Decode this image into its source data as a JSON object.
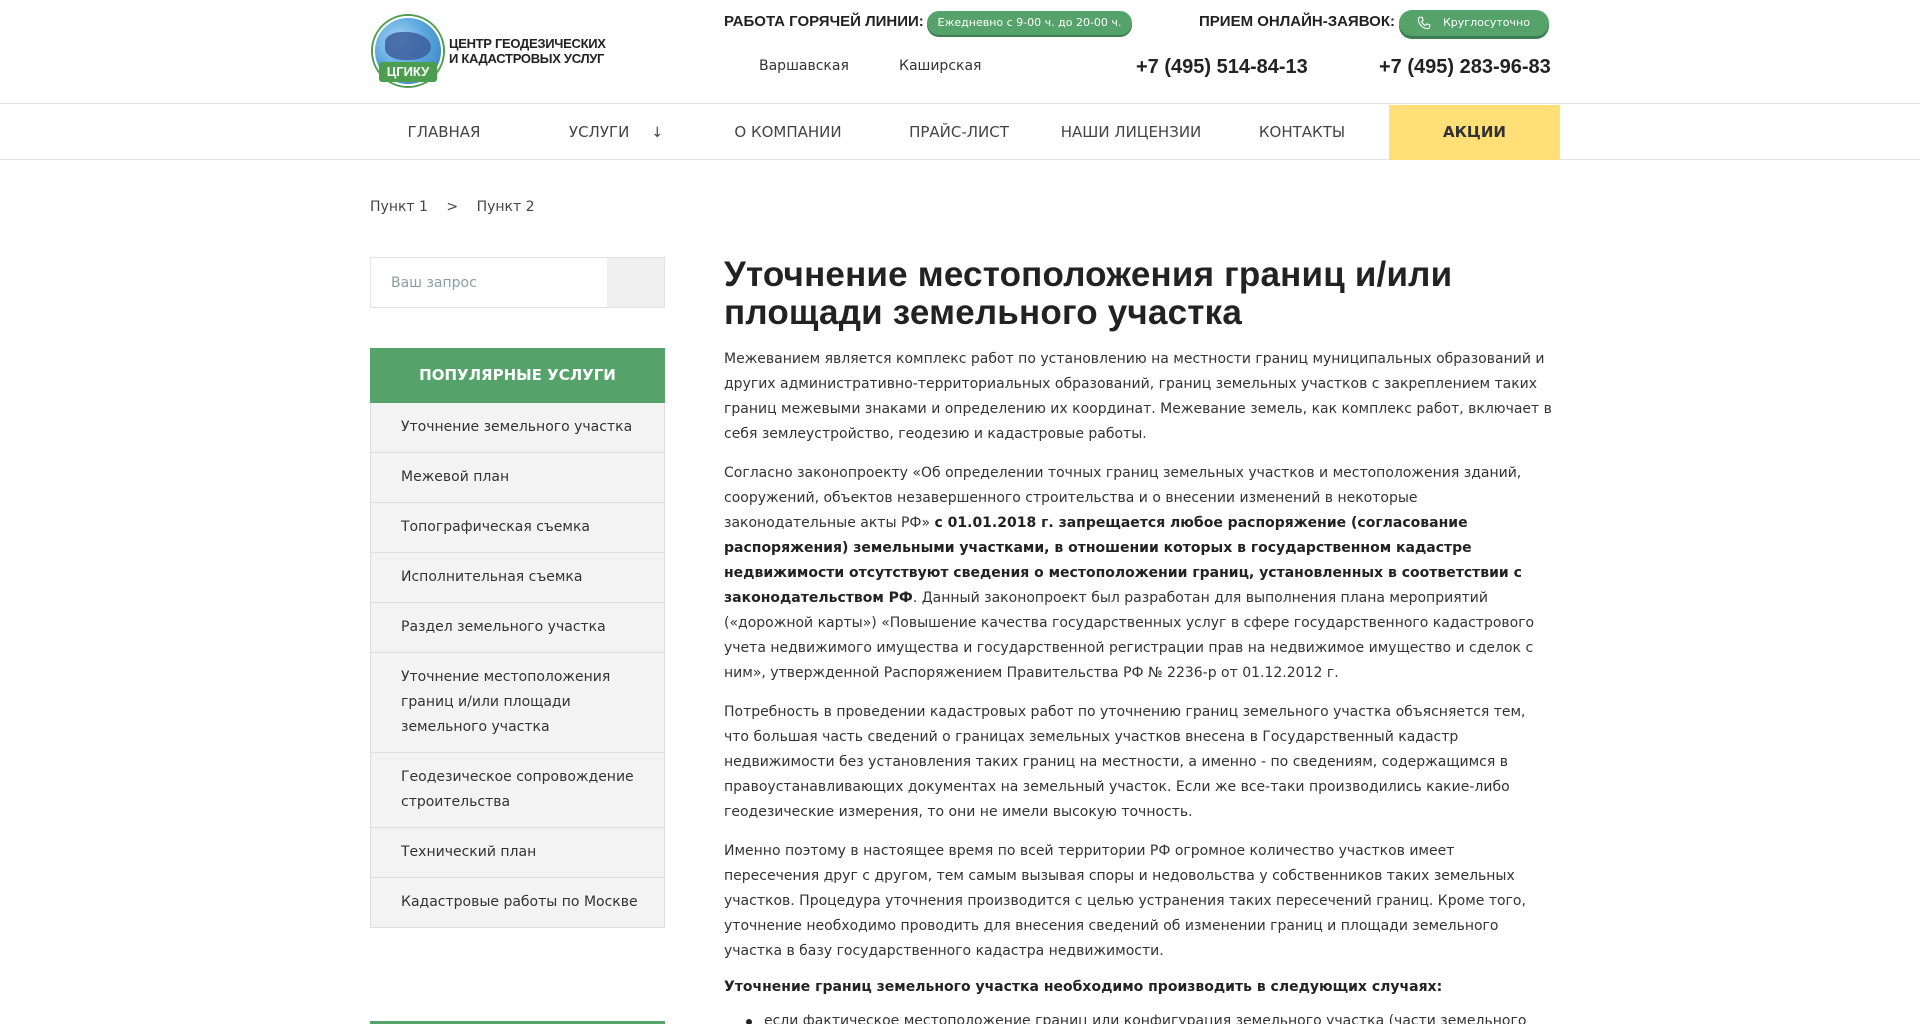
{
  "header": {
    "logo": {
      "badge": "ЦГИКУ",
      "text_line1": "ЦЕНТР ГЕОДЕЗИЧЕСКИХ",
      "text_line2": "И КАДАСТРОВЫХ УСЛУГ"
    },
    "hotline_label": "РАБОТА ГОРЯЧЕЙ ЛИНИИ:",
    "hotline_hours": "Ежедневно с 9-00 ч. до 20-00 ч.",
    "online_label": "ПРИЕМ ОНЛАЙН-ЗАЯВОК:",
    "online_hours": "Круглосуточно",
    "metro": [
      "Варшавская",
      "Каширская"
    ],
    "phones": [
      "+7 (495) 514-84-13",
      "+7 (495) 283-96-83"
    ]
  },
  "nav": {
    "items": [
      {
        "label": "Главная"
      },
      {
        "label": "Услуги",
        "arrow": "↓"
      },
      {
        "label": "О компании"
      },
      {
        "label": "Прайс-лист"
      },
      {
        "label": "Наши лицензии"
      },
      {
        "label": "Контакты"
      },
      {
        "label": "Акции"
      }
    ],
    "promo_color": "#ffdf76"
  },
  "breadcrumb": {
    "items": [
      "Пункт 1",
      "Пункт 2"
    ],
    "separator": ">"
  },
  "sidebar": {
    "search_placeholder": "Ваш запрос",
    "popular_title": "Популярные услуги",
    "items": [
      "Уточнение земельного участка",
      "Межевой план",
      "Топографическая съемка",
      "Исполнительная съемка",
      "Раздел земельного участка",
      "Уточнение местоположения границ и/или площади земельного участка",
      "Геодезическое сопровождение строительства",
      "Технический план",
      "Кадастровые работы по Москве"
    ]
  },
  "content": {
    "title": "Уточнение местоположения границ и/или площади земельного участка",
    "p1": "Межеванием является комплекс работ по установлению на местности границ муниципальных образований и других административно-территориальных образований, границ земельных участков с закреплением  таких границ межевыми знаками и определению  их координат. Межевание земель, как комплекс работ, включает в себя землеустройство, геодезию и кадастровые работы.",
    "p2_start": "Согласно законопроекту «Об определении точных границ земельных участков и местоположения зданий, сооружений, объектов незавершенного строительства и о внесении изменений в некоторые законодательные акты РФ» ",
    "p2_bold": "с 01.01.2018 г. запрещается любое распоряжение (согласование распоряжения) земельными участками, в отношении которых в государственном кадастре недвижимости отсутствуют сведения о местоположении границ, установленных в соответствии с законодательством РФ",
    "p2_end": ". Данный законопроект был разработан для выполнения плана мероприятий («дорожной карты») «Повышение качества государственных услуг в сфере государственного кадастрового учета недвижимого имущества и государственной регистрации прав на недвижимое имущество и сделок с ним», утвержденной Распоряжением Правительства РФ № 2236-р от 01.12.2012 г.",
    "p3": "Потребность в проведении кадастровых работ по уточнению границ земельного участка объясняется тем, что большая часть сведений о границах земельных участков внесена в Государственный кадастр недвижимости без установления таких границ на местности, а именно -  по сведениям, содержащимся в правоустанавливающих документах на земельный участок. Если же все-таки производились какие-либо геодезические измерения, то они не имели высокую точность.",
    "p4": "Именно поэтому в настоящее время по всей территории РФ огромное количество участков имеет пересечения друг с другом, тем самым вызывая споры и недовольства у собственников таких земельных участков. Процедура уточнения производится с целью устранения таких пересечений границ. Кроме того, уточнение необходимо проводить для внесения сведений об изменении границ и площади земельного участка в базу государственного кадастра недвижимости.",
    "subhead": "Уточнение границ земельного участка необходимо производить в следующих случаях:",
    "bullets": [
      "если фактическое местоположение границ или конфигурация земельного участка (части земельного участка)"
    ]
  },
  "colors": {
    "accent_green": "#55a36a",
    "promo_yellow": "#ffdf76",
    "text": "#333333"
  }
}
